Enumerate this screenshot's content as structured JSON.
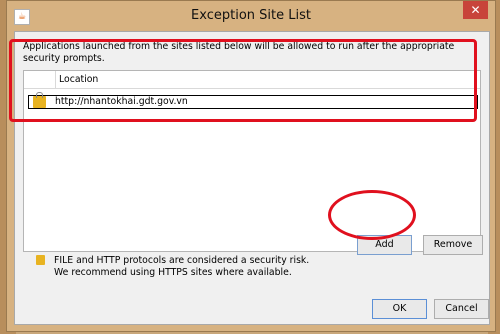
{
  "window": {
    "title": "Exception Site List",
    "app_icon_glyph": "☕",
    "close_glyph": "✕"
  },
  "description": "Applications launched from the sites listed below will be allowed to run after the appropriate security prompts.",
  "site_list": {
    "column_header": "Location",
    "rows": [
      {
        "url": "http://nhantokhai.gdt.gov.vn",
        "icon": "lock-icon"
      }
    ]
  },
  "buttons": {
    "add": "Add",
    "remove": "Remove",
    "ok": "OK",
    "cancel": "Cancel"
  },
  "warning": {
    "line1": "FILE and HTTP protocols are considered a security risk.",
    "line2": "We recommend using HTTPS sites where available.",
    "icon": "lock-icon"
  },
  "colors": {
    "highlight": "#e0101e",
    "accent_border": "#5b8fd6"
  }
}
